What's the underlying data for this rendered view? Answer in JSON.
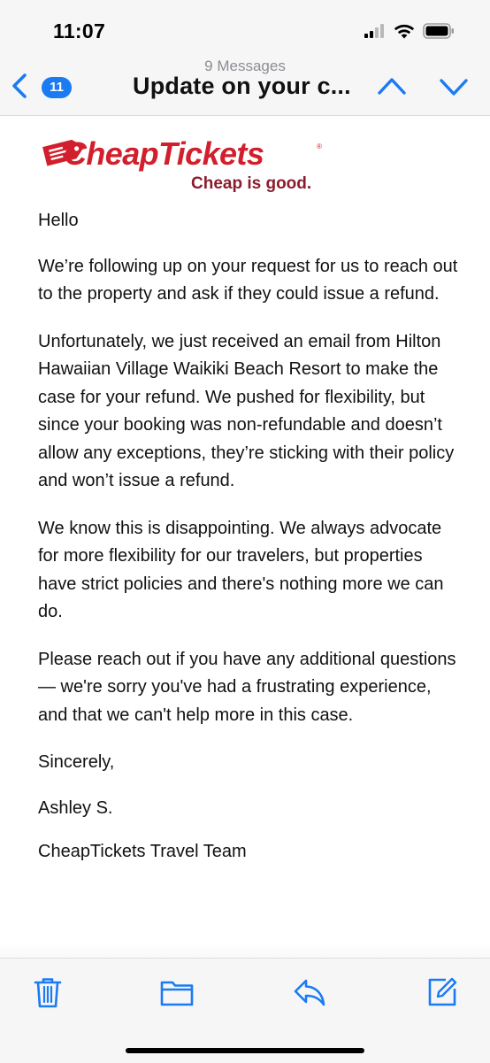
{
  "status_bar": {
    "time": "11:07"
  },
  "nav": {
    "badge_count": "11",
    "message_count": "9 Messages",
    "title": "Update on your c...",
    "icons": [
      "back-chevron-icon",
      "chevron-up-icon",
      "chevron-down-icon"
    ]
  },
  "logo": {
    "brand": "CheapTickets",
    "tagline": "Cheap is good."
  },
  "email": {
    "greeting": "Hello",
    "paragraphs": [
      "We’re following up on your request for us to reach out to the property and ask if they could issue a refund.",
      "Unfortunately, we just received an email from Hilton Hawaiian Village Waikiki Beach Resort to make the case for your refund. We pushed for flexibility, but since your booking was non-refundable and doesn’t allow any exceptions, they’re sticking with their policy and won’t issue a refund.",
      "We know this is disappointing. We always advocate for more flexibility for our travelers, but properties have strict policies and there's nothing more we can do.",
      "Please reach out if you have any additional questions — we're sorry you've had a frustrating experience, and that we can't help more in this case."
    ],
    "closing": "Sincerely,",
    "signature_name": "Ashley S.",
    "signature_team": "CheapTickets Travel Team"
  },
  "toolbar": {
    "icons": [
      "trash-icon",
      "folder-icon",
      "reply-icon",
      "compose-icon"
    ]
  },
  "colors": {
    "accent": "#1a7bf2",
    "brand_red": "#d21f2d",
    "brand_maroon": "#8a1d2d"
  }
}
